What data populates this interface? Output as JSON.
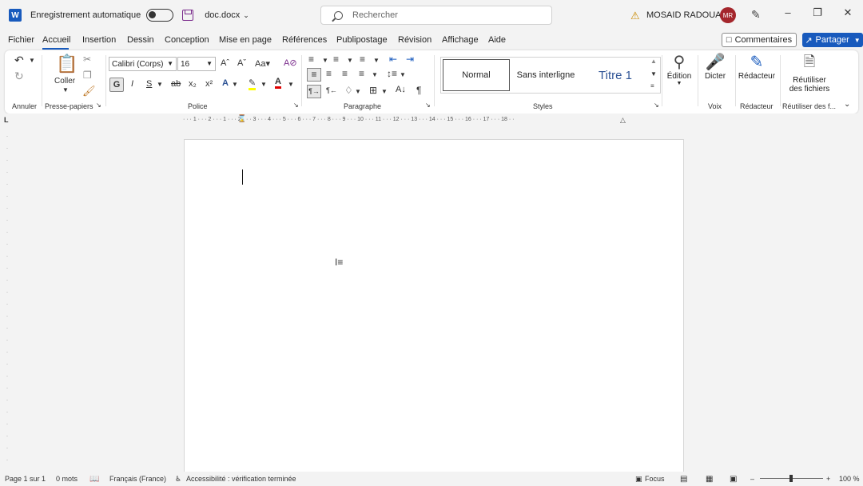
{
  "titlebar": {
    "autosave_label": "Enregistrement automatique",
    "doc_name": "doc.docx",
    "search_placeholder": "Rechercher",
    "user_name": "MOSAID RADOUAN",
    "user_initials": "MR"
  },
  "tabs": [
    "Fichier",
    "Accueil",
    "Insertion",
    "Dessin",
    "Conception",
    "Mise en page",
    "Références",
    "Publipostage",
    "Révision",
    "Affichage",
    "Aide"
  ],
  "active_tab": "Accueil",
  "actions": {
    "comments": "Commentaires",
    "share": "Partager"
  },
  "ribbon": {
    "groups": {
      "undo": "Annuler",
      "clipboard": "Presse-papiers",
      "font": "Police",
      "paragraph": "Paragraphe",
      "styles": "Styles",
      "voice": "Voix",
      "editor": "Rédacteur",
      "reuse": "Réutiliser des f..."
    },
    "paste_label": "Coller",
    "font_name": "Calibri (Corps)",
    "font_size": "16",
    "bold_label": "G",
    "italic_label": "I",
    "underline_label": "S",
    "styles": [
      "Normal",
      "Sans interligne",
      "Titre 1"
    ],
    "editing_label": "Édition",
    "dictate_label": "Dicter",
    "editor_label": "Rédacteur",
    "reuse_label_1": "Réutiliser",
    "reuse_label_2": "des fichiers"
  },
  "ruler_text": "· · · 1 · · · 2 · · · 1 · · · 2 · · · 3 · · · 4 · · · 5 · · · 6 · · · 7 · · · 8 · · · 9 · · · 10 · · · 11 · · · 12 · · · 13 · · · 14 · · · 15 · · · 16 · · · 17 · · · 18 · ·",
  "statusbar": {
    "page": "Page 1 sur 1",
    "words": "0 mots",
    "language": "Français (France)",
    "accessibility": "Accessibilité : vérification terminée",
    "focus": "Focus",
    "zoom": "100 %"
  },
  "colors": {
    "brand": "#185abd",
    "avatar": "#a4262c"
  }
}
